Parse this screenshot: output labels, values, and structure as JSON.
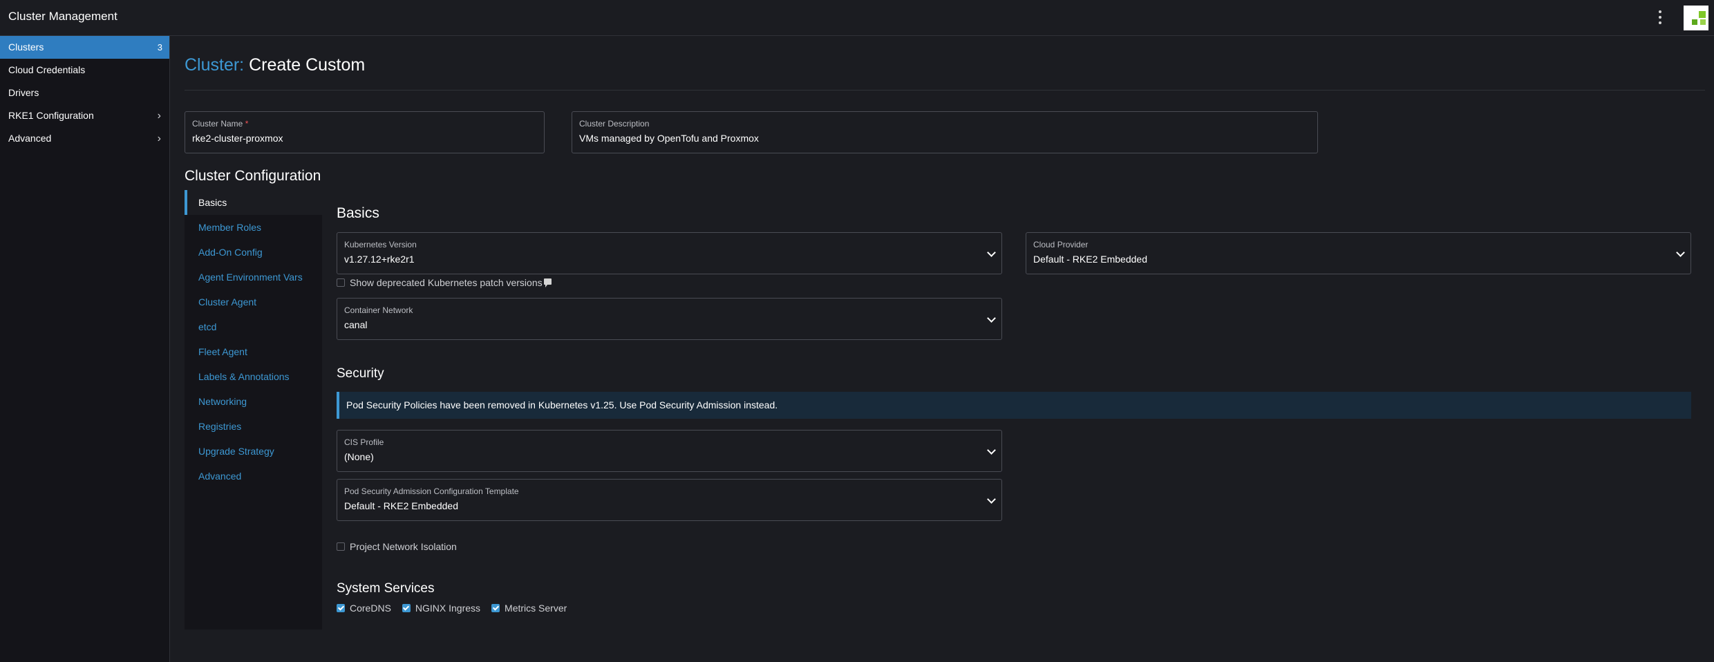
{
  "header": {
    "title": "Cluster Management"
  },
  "sidebar": {
    "items": [
      {
        "label": "Clusters",
        "count": "3"
      },
      {
        "label": "Cloud Credentials"
      },
      {
        "label": "Drivers"
      },
      {
        "label": "RKE1 Configuration"
      },
      {
        "label": "Advanced"
      }
    ]
  },
  "page": {
    "title_prefix": "Cluster:",
    "title": "Create Custom"
  },
  "form": {
    "cluster_name_label": "Cluster Name",
    "cluster_name_required": "*",
    "cluster_name_value": "rke2-cluster-proxmox",
    "cluster_description_label": "Cluster Description",
    "cluster_description_value": "VMs managed by OpenTofu and Proxmox"
  },
  "config": {
    "title": "Cluster Configuration",
    "tabs": [
      "Basics",
      "Member Roles",
      "Add-On Config",
      "Agent Environment Vars",
      "Cluster Agent",
      "etcd",
      "Fleet Agent",
      "Labels & Annotations",
      "Networking",
      "Registries",
      "Upgrade Strategy",
      "Advanced"
    ],
    "active_tab": "Basics"
  },
  "basics": {
    "title": "Basics",
    "k8s_version_label": "Kubernetes Version",
    "k8s_version_value": "v1.27.12+rke2r1",
    "cloud_provider_label": "Cloud Provider",
    "cloud_provider_value": "Default - RKE2 Embedded",
    "show_deprecated_label": "Show deprecated Kubernetes patch versions",
    "show_deprecated_checked": false,
    "container_network_label": "Container Network",
    "container_network_value": "canal"
  },
  "security": {
    "title": "Security",
    "banner": "Pod Security Policies have been removed in Kubernetes v1.25. Use Pod Security Admission instead.",
    "cis_label": "CIS Profile",
    "cis_value": "(None)",
    "psa_label": "Pod Security Admission Configuration Template",
    "psa_value": "Default - RKE2 Embedded",
    "project_isolation_label": "Project Network Isolation",
    "project_isolation_checked": false
  },
  "system_services": {
    "title": "System Services",
    "items": [
      {
        "label": "CoreDNS",
        "checked": true
      },
      {
        "label": "NGINX Ingress",
        "checked": true
      },
      {
        "label": "Metrics Server",
        "checked": true
      }
    ]
  },
  "colors": {
    "accent": "#3d98d3",
    "active_nav": "#2f7dc0",
    "background": "#1b1c21",
    "sidebar": "#141419",
    "required": "#f15356"
  },
  "icons": [
    "kebab-menu-icon",
    "avatar-icon",
    "chevron-right-icon",
    "chevron-down-icon",
    "info-icon",
    "checkbox-icon"
  ]
}
